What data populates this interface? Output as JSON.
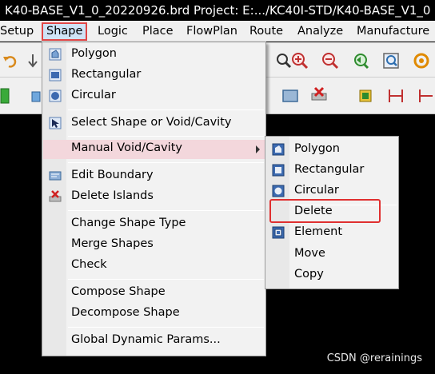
{
  "window": {
    "title": "K40-BASE_V1_0_20220926.brd  Project: E:.../KC40I-STD/K40-BASE_V1_0"
  },
  "menubar": [
    {
      "label": "Setup"
    },
    {
      "label": "Shape"
    },
    {
      "label": "Logic"
    },
    {
      "label": "Place"
    },
    {
      "label": "FlowPlan"
    },
    {
      "label": "Route"
    },
    {
      "label": "Analyze"
    },
    {
      "label": "Manufacture"
    }
  ],
  "shape_menu": {
    "items": [
      {
        "label": "Polygon",
        "icon": "polygon-icon"
      },
      {
        "label": "Rectangular",
        "icon": "rectangle-icon"
      },
      {
        "label": "Circular",
        "icon": "circle-icon"
      },
      {
        "label": "Select Shape or Void/Cavity",
        "icon": "select-shape-icon"
      },
      {
        "label": "Manual Void/Cavity",
        "icon": "",
        "highlighted": true
      },
      {
        "label": "Edit Boundary",
        "icon": "edit-boundary-icon"
      },
      {
        "label": "Delete Islands",
        "icon": "delete-islands-icon"
      },
      {
        "label": "Change Shape Type"
      },
      {
        "label": "Merge Shapes"
      },
      {
        "label": "Check"
      },
      {
        "label": "Compose Shape"
      },
      {
        "label": "Decompose Shape"
      },
      {
        "label": "Global Dynamic Params..."
      }
    ]
  },
  "void_submenu": {
    "items": [
      {
        "label": "Polygon",
        "icon": "void-polygon-icon"
      },
      {
        "label": "Rectangular",
        "icon": "void-rectangle-icon"
      },
      {
        "label": "Circular",
        "icon": "void-circle-icon"
      },
      {
        "label": "Delete",
        "icon": ""
      },
      {
        "label": "Element",
        "icon": "void-element-icon"
      },
      {
        "label": "Move",
        "icon": ""
      },
      {
        "label": "Copy",
        "icon": ""
      }
    ]
  },
  "watermark": "CSDN @rerainings",
  "colors": {
    "highlight": "#f3d7dc",
    "callout": "#e03030",
    "menu_bg": "#f2f2f2"
  }
}
